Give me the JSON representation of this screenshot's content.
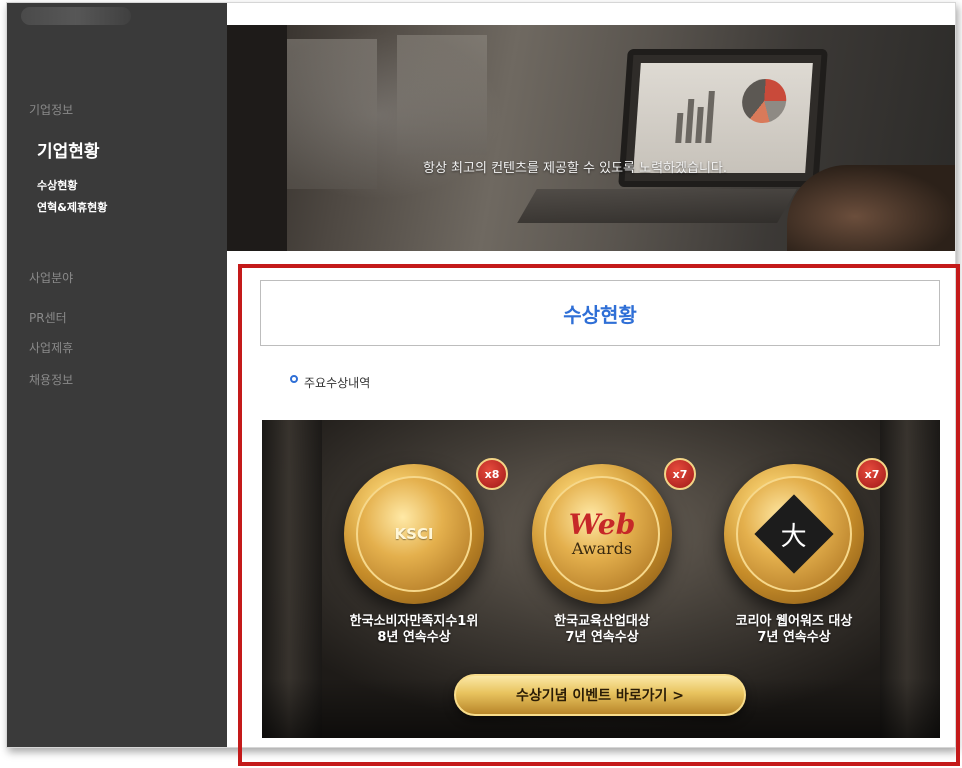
{
  "sidebar": {
    "section_label": "기업정보",
    "title": "기업현황",
    "sub_items": [
      "수상현황",
      "연혁&제휴현황"
    ],
    "categories": [
      "사업분야",
      "PR센터",
      "사업제휴",
      "채용정보"
    ]
  },
  "hero": {
    "tagline": "항상 최고의 컨텐츠를 제공할 수 있도록 노력하겠습니다."
  },
  "content": {
    "title": "수상현황",
    "bullet_label": "주요수상내역"
  },
  "awards": [
    {
      "badge": "x8",
      "emblem": "KSCI",
      "line1": "한국소비자만족지수1위",
      "line2": "8년 연속수상"
    },
    {
      "badge": "x7",
      "emblem_top": "Web",
      "emblem_bottom": "Awards",
      "line1": "한국교육산업대상",
      "line2": "7년 연속수상"
    },
    {
      "badge": "x7",
      "emblem": "大",
      "line1": "코리아 웹어워즈 대상",
      "line2": "7년 연속수상"
    }
  ],
  "event_button": {
    "label": "수상기념 이벤트 바로가기 >"
  },
  "colors": {
    "accent_blue": "#2f6fd6",
    "highlight_red": "#c41a1a",
    "sidebar_bg": "#3a3a3a"
  }
}
